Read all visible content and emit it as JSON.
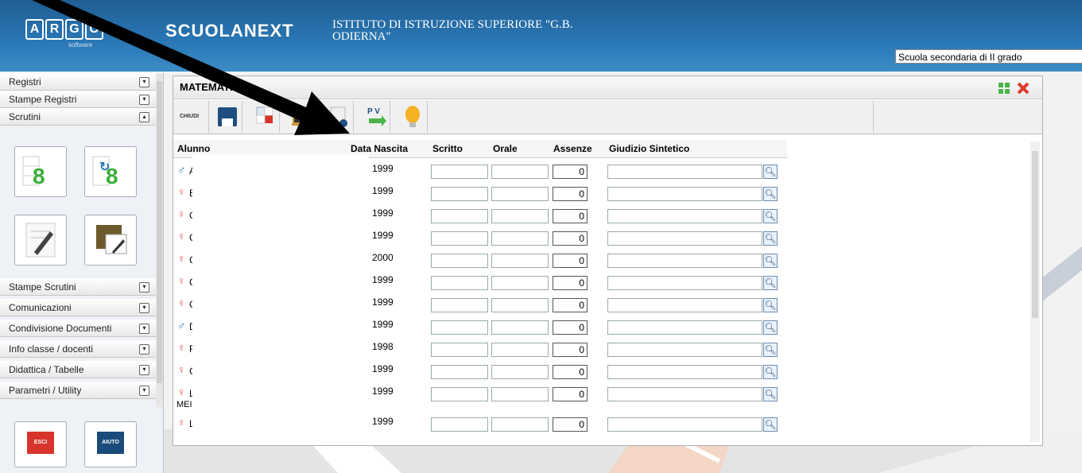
{
  "header": {
    "logo_letters": [
      "A",
      "R",
      "G",
      "O"
    ],
    "logo_sub": "software",
    "brand": "SCUOLANEXT",
    "school_line1": "ISTITUTO DI ISTRUZIONE SUPERIORE \"G.B.",
    "school_line2": "ODIERNA\"",
    "school_type": "Scuola secondaria di II grado"
  },
  "sidebar": {
    "items_top": [
      {
        "label": "Registri",
        "toggle": "▾"
      },
      {
        "label": "Stampe Registri",
        "toggle": "▾"
      },
      {
        "label": "Scrutini",
        "toggle": "▴"
      }
    ],
    "items_bottom": [
      {
        "label": "Stampe Scrutini",
        "toggle": "▾"
      },
      {
        "label": "Comunicazioni",
        "toggle": "▾"
      },
      {
        "label": "Condivisione Documenti",
        "toggle": "▾"
      },
      {
        "label": "Info classe / docenti",
        "toggle": "▾"
      },
      {
        "label": "Didattica / Tabelle",
        "toggle": "▾"
      },
      {
        "label": "Parametri / Utility",
        "toggle": "▾"
      }
    ],
    "exit_label": "ESCI",
    "help_label": "AIUTO",
    "tile_digit": "8"
  },
  "panel": {
    "title": "MATEMATICA",
    "close_label": "CHIUDI",
    "pv_label": "P V"
  },
  "grid": {
    "headers": [
      "Alunno",
      "Data Nascita",
      "Scritto",
      "Orale",
      "Assenze",
      "Giudizio Sintetico"
    ],
    "rows": [
      {
        "gender": "♂",
        "initial": "A",
        "year": "1999",
        "absences": "0"
      },
      {
        "gender": "♀",
        "initial": "E",
        "year": "1999",
        "absences": "0"
      },
      {
        "gender": "♀",
        "initial": "C",
        "year": "1999",
        "absences": "0"
      },
      {
        "gender": "♀",
        "initial": "C",
        "year": "1999",
        "absences": "0"
      },
      {
        "gender": "♀",
        "initial": "C",
        "year": "2000",
        "absences": "0"
      },
      {
        "gender": "♀",
        "initial": "C",
        "year": "1999",
        "absences": "0"
      },
      {
        "gender": "♀",
        "initial": "C",
        "year": "1999",
        "absences": "0"
      },
      {
        "gender": "♂",
        "initial": "D",
        "year": "1999",
        "absences": "0"
      },
      {
        "gender": "♀",
        "initial": "F",
        "year": "1998",
        "absences": "0"
      },
      {
        "gender": "♀",
        "initial": "C",
        "year": "1999",
        "absences": "0"
      },
      {
        "gender": "♀",
        "initial": "L",
        "extra": "MEI",
        "year": "1999",
        "absences": "0"
      },
      {
        "gender": "♀",
        "initial": "L",
        "year": "1999",
        "absences": "0"
      }
    ]
  },
  "colors": {
    "female": "#d9534f",
    "male": "#2a74c0",
    "header_blue": "#2a78b6"
  }
}
